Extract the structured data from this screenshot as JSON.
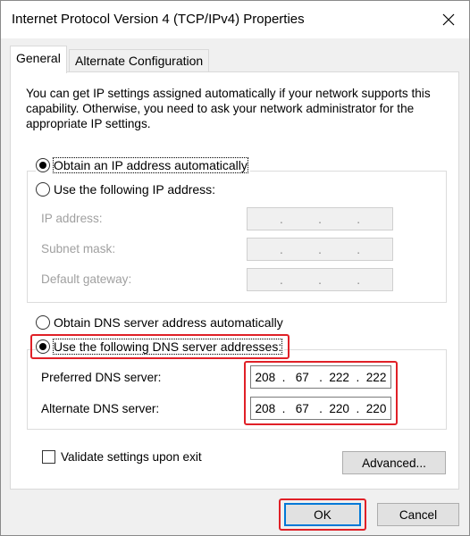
{
  "window": {
    "title": "Internet Protocol Version 4 (TCP/IPv4) Properties",
    "close_icon": "close-icon"
  },
  "tabs": [
    {
      "label": "General",
      "active": true
    },
    {
      "label": "Alternate Configuration",
      "active": false
    }
  ],
  "description": "You can get IP settings assigned automatically if your network supports this capability. Otherwise, you need to ask your network administrator for the appropriate IP settings.",
  "ip_mode": {
    "auto_label": "Obtain an IP address automatically",
    "auto_selected": true,
    "manual_label": "Use the following IP address:",
    "manual_selected": false,
    "fields": [
      {
        "label": "IP address:",
        "value": [
          "",
          "",
          "",
          ""
        ]
      },
      {
        "label": "Subnet mask:",
        "value": [
          "",
          "",
          "",
          ""
        ]
      },
      {
        "label": "Default gateway:",
        "value": [
          "",
          "",
          "",
          ""
        ]
      }
    ]
  },
  "dns_mode": {
    "auto_label": "Obtain DNS server address automatically",
    "auto_selected": false,
    "manual_label": "Use the following DNS server addresses:",
    "manual_selected": true,
    "preferred": {
      "label": "Preferred DNS server:",
      "value": [
        "208",
        "67",
        "222",
        "222"
      ]
    },
    "alternate": {
      "label": "Alternate DNS server:",
      "value": [
        "208",
        "67",
        "220",
        "220"
      ]
    }
  },
  "validate": {
    "label": "Validate settings upon exit",
    "checked": false
  },
  "buttons": {
    "advanced": "Advanced...",
    "ok": "OK",
    "cancel": "Cancel"
  },
  "colors": {
    "highlight": "#e02027",
    "default_button_border": "#0078d7"
  }
}
